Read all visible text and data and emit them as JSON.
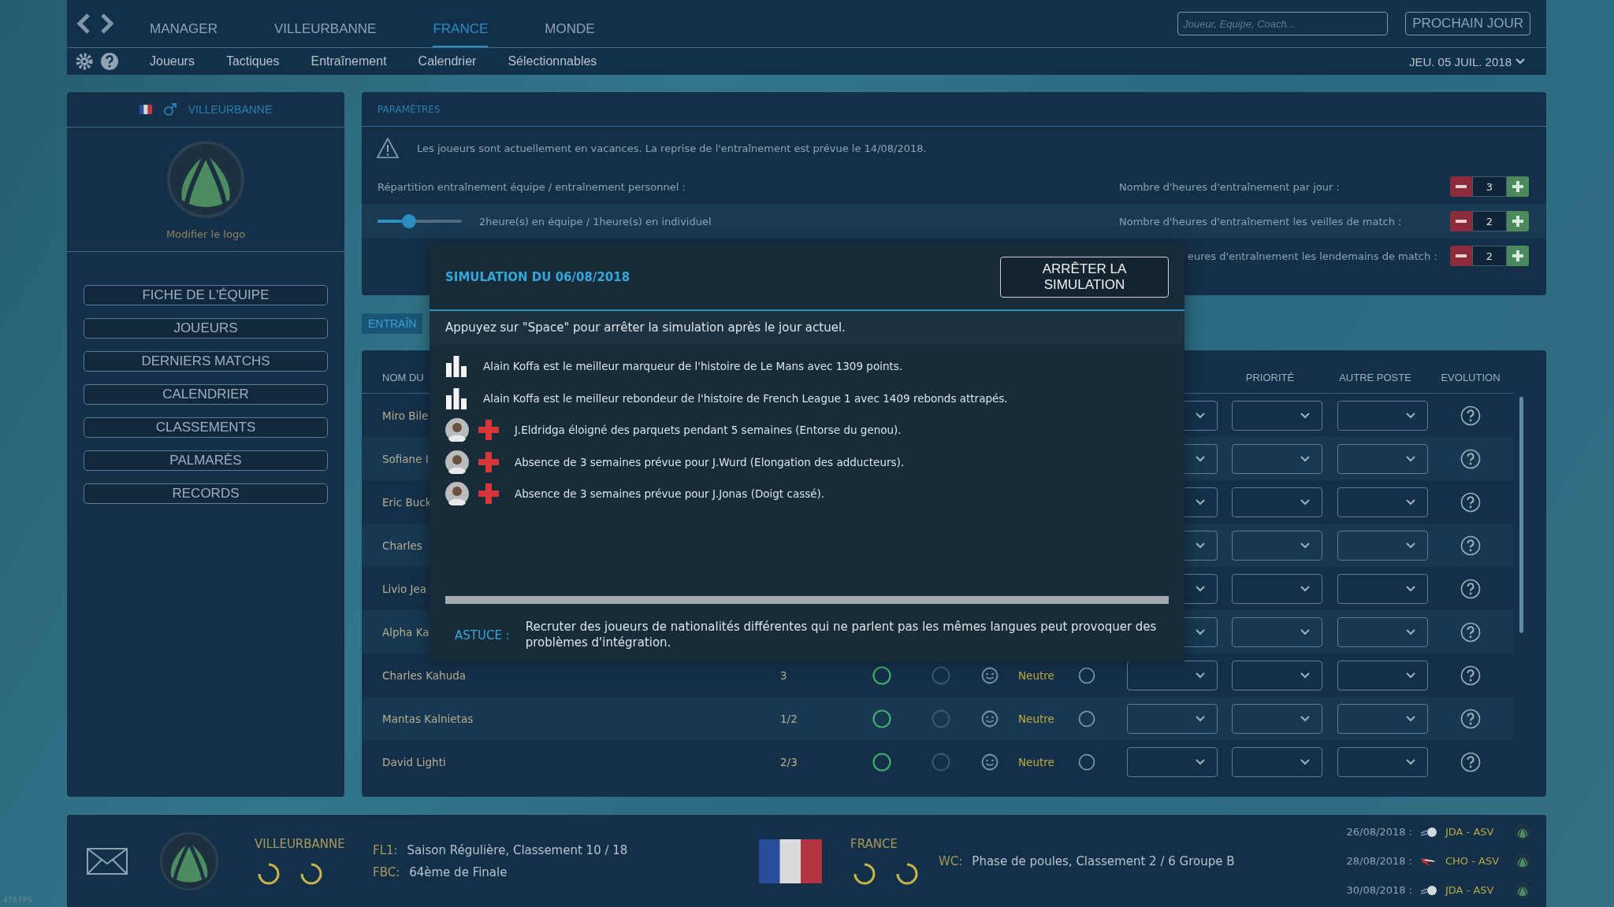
{
  "nav_tabs": [
    {
      "label": "MANAGER",
      "selected": false
    },
    {
      "label": "VILLEURBANNE",
      "selected": false
    },
    {
      "label": "FRANCE",
      "selected": true
    },
    {
      "label": "MONDE",
      "selected": false
    }
  ],
  "search": {
    "placeholder": "Joueur, Equipe, Coach..."
  },
  "next_day_button": "PROCHAIN JOUR",
  "sub_tabs": [
    "Joueurs",
    "Tactiques",
    "Entraînement",
    "Calendrier",
    "Sélectionnables"
  ],
  "date": "JEU. 05 JUIL. 2018",
  "team_panel": {
    "name": "VILLEURBANNE",
    "logo_link": "Modifier le logo",
    "buttons": [
      "FICHE DE L'ÉQUIPE",
      "JOUEURS",
      "DERNIERS MATCHS",
      "CALENDRIER",
      "CLASSEMENTS",
      "PALMARÈS",
      "RECORDS"
    ]
  },
  "parameters": {
    "title": "PARAMÈTRES",
    "notice": "Les joueurs sont actuellement en vacances. La reprise de l'entraînement est prévue le 14/08/2018.",
    "split_label": "Répartition entraînement équipe / entraînement personnel :",
    "split_slider": {
      "level": 0.37
    },
    "split_reading": "2heure(s) en équipe / 1heure(s) en individuel",
    "hours": [
      {
        "label": "Nombre d'heures d'entraînement par jour :",
        "value": "3"
      },
      {
        "label": "Nombre d'heures d'entraînement les veilles de match :",
        "value": "2"
      },
      {
        "label_tail": "eures d'entraînement les lendemains de match :",
        "value": "2"
      }
    ]
  },
  "section_tab": "ENTRAÎN",
  "table": {
    "columns": {
      "name": "NOM DU",
      "priority": "PRIORITÉ",
      "other_position": "AUTRE POSTE",
      "evolution": "EVOLUTION"
    },
    "rows": [
      {
        "name": "Miro Bile"
      },
      {
        "name": "Sofiane I"
      },
      {
        "name": "Eric Buck"
      },
      {
        "name": "Charles"
      },
      {
        "name": "Livio Jea"
      },
      {
        "name": "Alpha Ka"
      },
      {
        "name": "Charles Kahuda",
        "poste": "3",
        "avis": "Neutre"
      },
      {
        "name": "Mantas Kalnietas",
        "poste": "1/2",
        "avis": "Neutre"
      },
      {
        "name": "David Lighti",
        "poste": "2/3",
        "avis": "Neutre"
      }
    ]
  },
  "dialog": {
    "title": "SIMULATION DU 06/08/2018",
    "stop_button": "ARRÊTER LA SIMULATION",
    "instruction": "Appuyez sur \"Space\" pour arrêter la simulation après le jour actuel.",
    "events": [
      {
        "kind": "record",
        "text": "Alain Koffa est le meilleur marqueur de l'histoire de Le Mans avec 1309 points."
      },
      {
        "kind": "record",
        "text": "Alain Koffa est le meilleur rebondeur de l'histoire de French League 1 avec 1409 rebonds attrapés."
      },
      {
        "kind": "injury",
        "text": "J.Eldridga éloigné des parquets pendant 5 semaines (Entorse du genou)."
      },
      {
        "kind": "injury",
        "text": "Absence de 3 semaines prévue pour J.Wurd (Elongation des adducteurs)."
      },
      {
        "kind": "injury",
        "text": "Absence de 3 semaines prévue pour J.Jonas (Doigt cassé)."
      }
    ],
    "progress": {
      "level": 1
    },
    "tip_label": "ASTUCE :",
    "tip": "Recruter des joueurs de nationalités différentes qui ne parlent pas les mêmes langues peut provoquer des problèmes d'intégration."
  },
  "status_bar": {
    "club": {
      "name": "VILLEURBANNE",
      "competitions": [
        {
          "code": "FL1:",
          "text": "Saison Régulière, Classement 10 / 18"
        },
        {
          "code": "FBC:",
          "text": "64ème de Finale"
        }
      ]
    },
    "nation": {
      "name": "FRANCE",
      "competitions": [
        {
          "code": "WC:",
          "text": "Phase de poules, Classement 2 / 6 Groupe B"
        }
      ]
    },
    "matches": [
      {
        "date": "26/08/2018 :",
        "kind": "ball",
        "teams": "JDA - ASV"
      },
      {
        "date": "28/08/2018 :",
        "kind": "bird",
        "teams": "CHO - ASV"
      },
      {
        "date": "30/08/2018 :",
        "kind": "ball",
        "teams": "JDA - ASV"
      }
    ]
  },
  "fps": "474 FPS"
}
